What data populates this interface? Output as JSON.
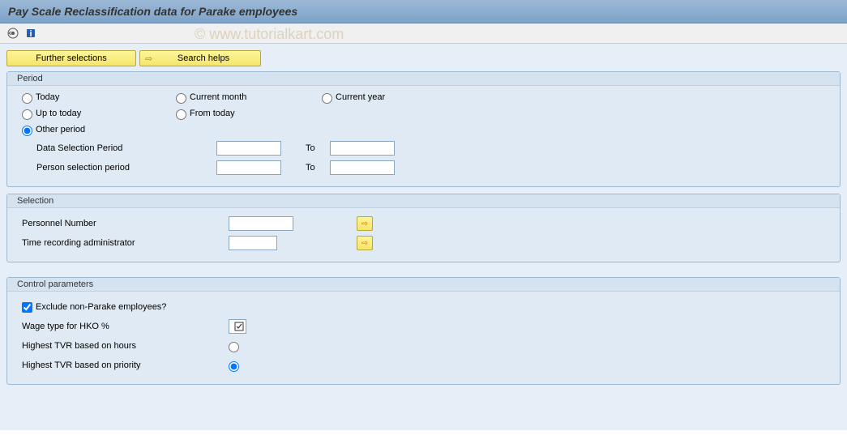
{
  "title": "Pay Scale Reclassification data for Parake employees",
  "watermark": "© www.tutorialkart.com",
  "buttons": {
    "further_selections": "Further selections",
    "search_helps": "Search helps"
  },
  "period": {
    "group_label": "Period",
    "today": "Today",
    "current_month": "Current month",
    "current_year": "Current year",
    "up_to_today": "Up to today",
    "from_today": "From today",
    "other_period": "Other period",
    "data_selection_period": "Data Selection Period",
    "person_selection_period": "Person selection period",
    "to_label": "To"
  },
  "selection": {
    "group_label": "Selection",
    "personnel_number": "Personnel Number",
    "time_recording_admin": "Time recording administrator"
  },
  "control": {
    "group_label": "Control parameters",
    "exclude_non_parake": "Exclude non-Parake employees?",
    "wage_type_hko": "Wage type for HKO %",
    "highest_tvr_hours": "Highest TVR based on hours",
    "highest_tvr_priority": "Highest TVR based on priority"
  }
}
